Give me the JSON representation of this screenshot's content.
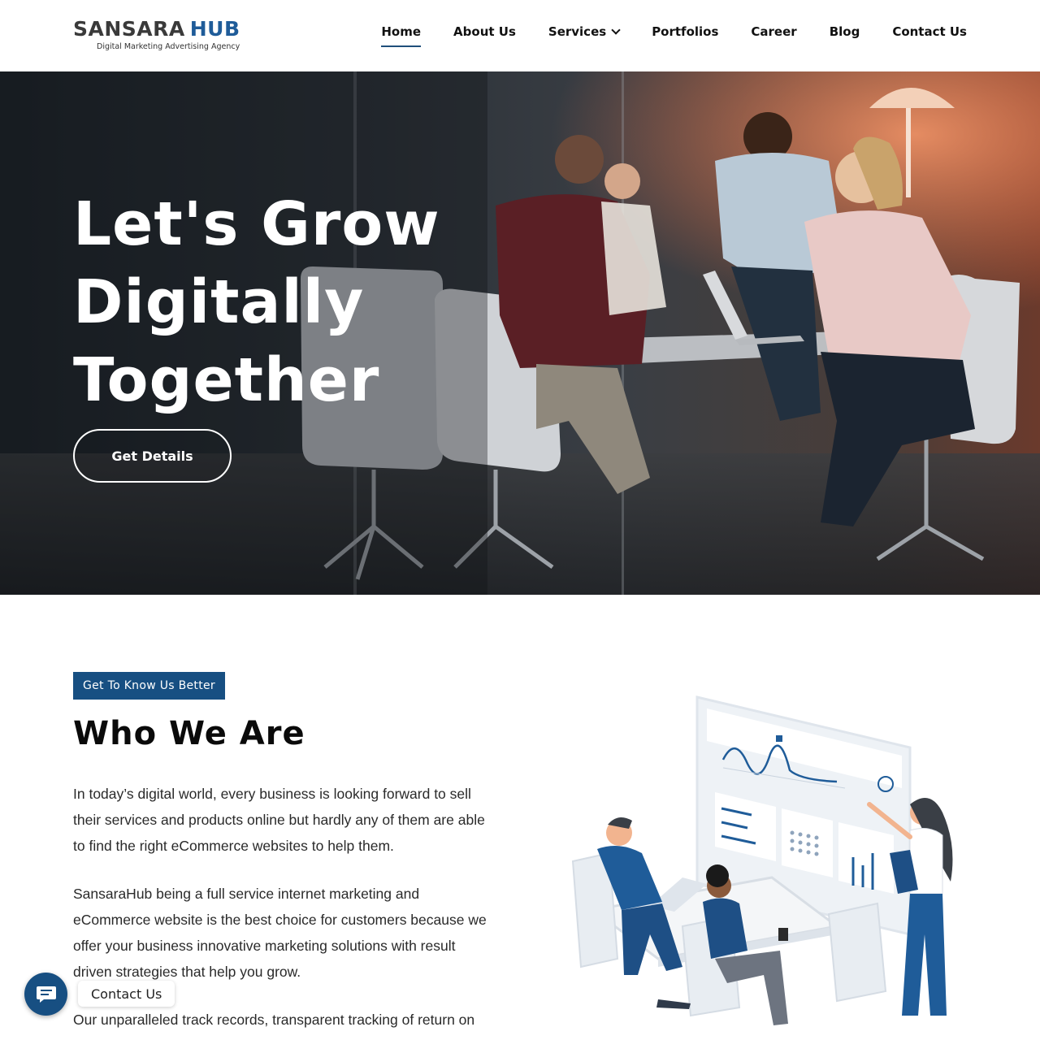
{
  "brand": {
    "name_part1": "SANSARA",
    "name_part2": "HUB",
    "tagline": "Digital Marketing Advertising Agency",
    "colors": {
      "primary": "#174f82",
      "text": "#111111",
      "logo_gray": "#3a3a3a"
    }
  },
  "nav": {
    "items": [
      {
        "label": "Home",
        "active": true
      },
      {
        "label": "About Us"
      },
      {
        "label": "Services",
        "has_dropdown": true
      },
      {
        "label": "Portfolios"
      },
      {
        "label": "Career"
      },
      {
        "label": "Blog"
      },
      {
        "label": "Contact Us"
      }
    ]
  },
  "hero": {
    "title_lines": [
      "Let's Grow",
      "Digitally",
      "Together"
    ],
    "cta_label": "Get Details"
  },
  "about": {
    "badge": "Get To Know Us Better",
    "title": "Who We Are",
    "paragraphs": [
      "In today’s digital world, every business is looking forward to sell their services and products online but hardly any of them are able to find the right eCommerce websites to help them.",
      "SansaraHub being a full service internet marketing and eCommerce website is the best choice for customers because we offer your business innovative marketing solutions with result driven strategies that help you grow.",
      "Our unparalleled track records, transparent tracking of return on"
    ]
  },
  "floating_contact": {
    "label": "Contact Us",
    "icon": "chat-icon"
  }
}
